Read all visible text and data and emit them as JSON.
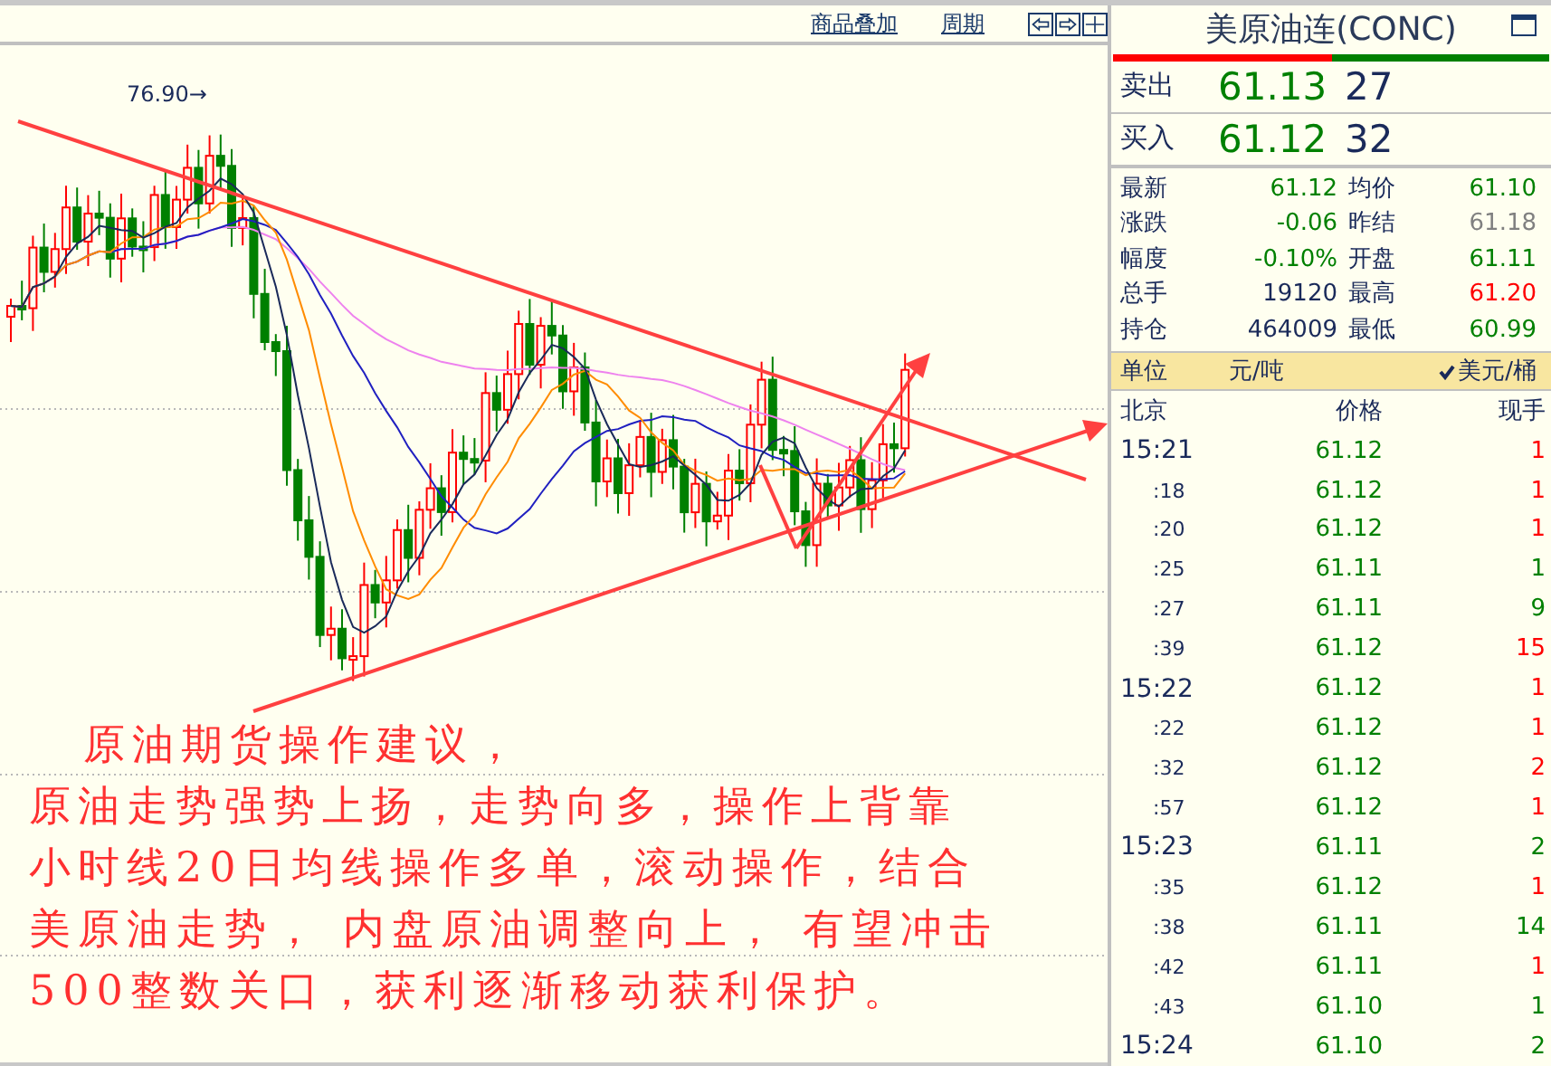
{
  "toolbar": {
    "links": [
      "商品叠加",
      "周期"
    ]
  },
  "chart": {
    "peak_label": "76.90→"
  },
  "annotation": {
    "title": "原油期货操作建议，",
    "lines": [
      "原油走势强势上扬，走势向多，操作上背靠",
      "小时线20日均线操作多单，滚动操作，结合",
      "美原油走势， 内盘原油调整向上， 有望冲击",
      "500整数关口，获利逐渐移动获利保护。"
    ]
  },
  "quote": {
    "title": "美原油连(CONC)",
    "book": [
      {
        "label": "卖出",
        "price": "61.13",
        "volume": "27"
      },
      {
        "label": "买入",
        "price": "61.12",
        "volume": "32"
      }
    ],
    "stats": [
      {
        "label": "最新",
        "value": "61.12",
        "color": "#008000"
      },
      {
        "label": "均价",
        "value": "61.10",
        "color": "#008000"
      },
      {
        "label": "涨跌",
        "value": "-0.06",
        "color": "#008000"
      },
      {
        "label": "昨结",
        "value": "61.18",
        "color": "#808080"
      },
      {
        "label": "幅度",
        "value": "-0.10%",
        "color": "#008000"
      },
      {
        "label": "开盘",
        "value": "61.11",
        "color": "#008000"
      },
      {
        "label": "总手",
        "value": "19120",
        "color": "#1a2a5a"
      },
      {
        "label": "最高",
        "value": "61.20",
        "color": "#ff0000"
      },
      {
        "label": "持仓",
        "value": "464009",
        "color": "#1a2a5a"
      },
      {
        "label": "最低",
        "value": "60.99",
        "color": "#008000"
      }
    ],
    "unit_label": "单位",
    "units": [
      {
        "label": "元/吨",
        "selected": false
      },
      {
        "label": "美元/桶",
        "selected": true
      }
    ],
    "columns": [
      "北京",
      "价格",
      "现手"
    ],
    "ticks": [
      {
        "time": "15:21",
        "kind": "minute",
        "price": "61.12",
        "volume": "1",
        "color": "#ff0000"
      },
      {
        "time": ":18",
        "kind": "second",
        "price": "61.12",
        "volume": "1",
        "color": "#ff0000"
      },
      {
        "time": ":20",
        "kind": "second",
        "price": "61.12",
        "volume": "1",
        "color": "#ff0000"
      },
      {
        "time": ":25",
        "kind": "second",
        "price": "61.11",
        "volume": "1",
        "color": "#008000"
      },
      {
        "time": ":27",
        "kind": "second",
        "price": "61.11",
        "volume": "9",
        "color": "#008000"
      },
      {
        "time": ":39",
        "kind": "second",
        "price": "61.12",
        "volume": "15",
        "color": "#ff0000"
      },
      {
        "time": "15:22",
        "kind": "minute",
        "price": "61.12",
        "volume": "1",
        "color": "#ff0000"
      },
      {
        "time": ":22",
        "kind": "second",
        "price": "61.12",
        "volume": "1",
        "color": "#ff0000"
      },
      {
        "time": ":32",
        "kind": "second",
        "price": "61.12",
        "volume": "2",
        "color": "#ff0000"
      },
      {
        "time": ":57",
        "kind": "second",
        "price": "61.12",
        "volume": "1",
        "color": "#ff0000"
      },
      {
        "time": "15:23",
        "kind": "minute",
        "price": "61.11",
        "volume": "2",
        "color": "#008000"
      },
      {
        "time": ":35",
        "kind": "second",
        "price": "61.12",
        "volume": "1",
        "color": "#ff0000"
      },
      {
        "time": ":38",
        "kind": "second",
        "price": "61.11",
        "volume": "14",
        "color": "#008000"
      },
      {
        "time": ":42",
        "kind": "second",
        "price": "61.11",
        "volume": "1",
        "color": "#ff0000"
      },
      {
        "time": ":43",
        "kind": "second",
        "price": "61.10",
        "volume": "1",
        "color": "#008000"
      },
      {
        "time": "15:24",
        "kind": "minute",
        "price": "61.10",
        "volume": "2",
        "color": "#008000"
      }
    ]
  }
}
